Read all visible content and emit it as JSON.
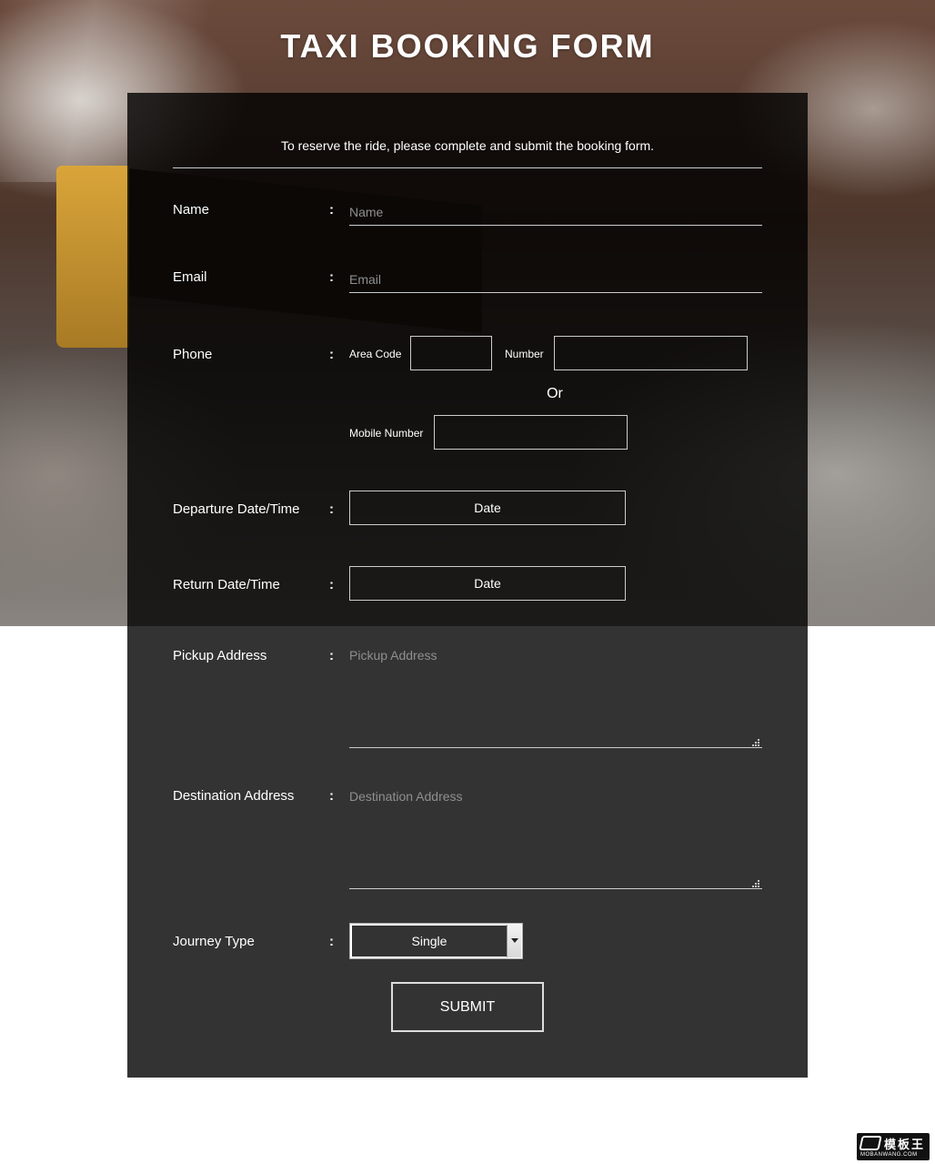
{
  "page": {
    "title": "TAXI BOOKING FORM",
    "intro": "To reserve the ride, please complete and submit the booking form."
  },
  "colors": {
    "panel_overlay": "#000000",
    "panel_dark": "#333333",
    "text": "#ffffff",
    "placeholder": "#8f8f8f",
    "rule": "#cccccc"
  },
  "form": {
    "separator": ":",
    "name": {
      "label": "Name",
      "placeholder": "Name",
      "value": ""
    },
    "email": {
      "label": "Email",
      "placeholder": "Email",
      "value": ""
    },
    "phone": {
      "label": "Phone",
      "area_code_label": "Area Code",
      "number_label": "Number",
      "or_text": "Or",
      "mobile_label": "Mobile Number"
    },
    "departure": {
      "label": "Departure Date/Time",
      "button": "Date"
    },
    "return": {
      "label": "Return Date/Time",
      "button": "Date"
    },
    "pickup": {
      "label": "Pickup Address",
      "placeholder": "Pickup Address"
    },
    "destination": {
      "label": "Destination Address",
      "placeholder": "Destination Address"
    },
    "journey": {
      "label": "Journey Type",
      "selected": "Single"
    },
    "submit": "SUBMIT"
  },
  "watermark": {
    "cn": "模板王",
    "en": "MOBANWANG.COM"
  },
  "icons": [
    "chevron-down-icon",
    "resize-grip-icon",
    "logo-icon"
  ]
}
